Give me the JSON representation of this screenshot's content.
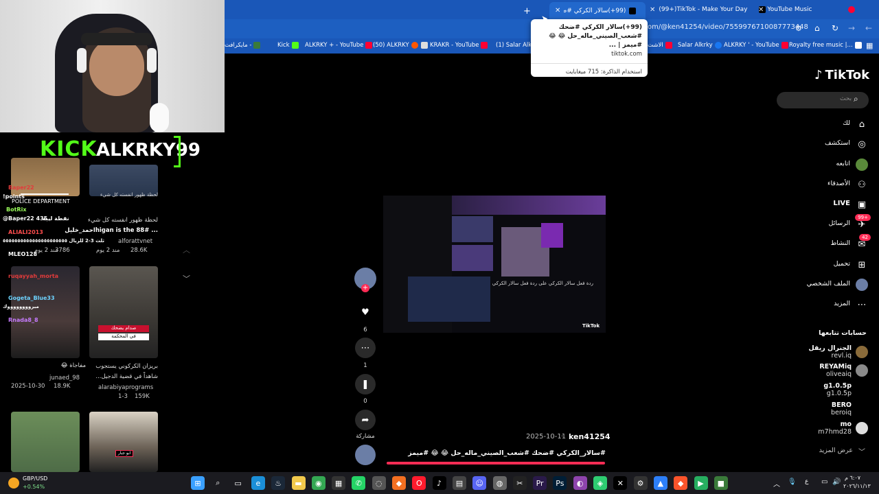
{
  "browser": {
    "tabs": [
      {
        "label": "(99+)سالار الكركي #ضحك #شـ",
        "active": true
      },
      {
        "label": "(99+)TikTok - Make Your Day",
        "active": false
      },
      {
        "label": "YouTube Music",
        "active": false
      }
    ],
    "new_tab_glyph": "+",
    "url": "om/@ken41254/video/7559976710087773448",
    "bookmarks": [
      "مايكرافت -",
      "Kick",
      "ALKRKY + - YouTube",
      "(50) ALKRKY",
      "KRAKR - YouTube",
      "(1) Salar Alkrk",
      "الاشت",
      "Salar Alkrky",
      "ALKRKY ' - YouTube",
      "Royalty free music |..."
    ]
  },
  "tooltip": {
    "line1": "(99+)سالار الكركي #ضحك",
    "line2": "#شعب_الصيني_ماله_حل 😂 😂 #ميمز | ...",
    "site": "tiktok.com",
    "memory": "استخدام الذاكرة: 715 ميغابايت"
  },
  "stream": {
    "platform": "KICK",
    "channel": "ALKRKY99"
  },
  "chat": [
    {
      "user": "Baper22",
      "text": "",
      "color": "#e23b3b"
    },
    {
      "user": "!points",
      "text": "",
      "color": "#ffffff"
    },
    {
      "user": "BotRix",
      "text": "",
      "color": "#9cff5c"
    },
    {
      "user": "@Baper22 435",
      "text": "نقطة ليبه",
      "color": "#ffffff"
    },
    {
      "user": "ALIALI2013",
      "text": "",
      "color": "#ff4d4d"
    },
    {
      "user": "",
      "text": "يرنهوه البارحه برتشوله ثلث 3-2 للريال ٥٥٥٥٥٥٥٥٥٥٥٥٥٥٥٥٥٥٥٥٥٥",
      "color": "#ffffff"
    },
    {
      "user": "MLEO128",
      "text": "",
      "color": "#ffffff"
    },
    {
      "user": "ruqayyah_morta",
      "text": "",
      "color": "#e23b3b"
    },
    {
      "user": "Gogeta_Blue33",
      "text": "",
      "color": "#6dd3ff"
    },
    {
      "user": "",
      "text": "مبرووووووووك",
      "color": "#ffffff"
    },
    {
      "user": "Rnada8_8",
      "text": "",
      "color": "#c67bff"
    }
  ],
  "feed": [
    {
      "title": "لحظة ظهور انفسته كل شيء",
      "title2": "... higan is the 88#احمد_خليل",
      "author": "alforattvnet",
      "meta": "مند 2 يوم",
      "views": "3786",
      "likes": "28.6K"
    },
    {
      "title": "بريزان الكركوني يستجوب",
      "title2": "شاهداً في قضية الدجيل...",
      "author": "alarabiyaprograms",
      "meta": "1-3",
      "views": "159K"
    },
    {
      "title": "مفاجاة 😂",
      "author": "junaed_98",
      "meta": "2025-10-30",
      "views": "18.9K"
    }
  ],
  "thumb_labels": {
    "police": "POLICE DEPARTMENT",
    "saddam": "صدام يضحك",
    "court": "في المحكمة",
    "abujebar": "ابو جبار"
  },
  "video": {
    "author": "ken41254",
    "date": "2025-10-11",
    "caption": "#سالار_الكركي #ضحك #شعب_الصيني_ماله_حل 😂 😂 #ميمز",
    "overlay_text": "ردة فعل سالار الكركي على ردة فعل سالار الكركي على",
    "watermark": "TikTok",
    "likes": "6",
    "comments": "1",
    "saves": "0",
    "share_label": "مشاركة"
  },
  "tiktok": {
    "logo": "TikTok",
    "search_placeholder": "بحث",
    "nav": [
      {
        "label": "لك",
        "icon": "home-icon"
      },
      {
        "label": "استكشف",
        "icon": "compass-icon"
      },
      {
        "label": "اتابعه",
        "icon": "following-icon"
      },
      {
        "label": "الأصدقاء",
        "icon": "friends-icon"
      },
      {
        "label": "LIVE",
        "icon": "live-icon"
      },
      {
        "label": "الرسائل",
        "icon": "messages-icon",
        "badge": "99+"
      },
      {
        "label": "النشاط",
        "icon": "activity-icon",
        "badge": "42"
      },
      {
        "label": "تحميل",
        "icon": "upload-icon"
      },
      {
        "label": "الملف الشخصي",
        "icon": "profile-icon"
      },
      {
        "label": "المزيد",
        "icon": "more-icon"
      }
    ],
    "following_title": "حسابات تتابعها",
    "following": [
      {
        "name": "الجنرال ريقل",
        "handle": "revl.iq"
      },
      {
        "name": "REYAMiq",
        "handle": "oliveaiq"
      },
      {
        "name": "g1.0.5p",
        "handle": "g1.0.5p"
      },
      {
        "name": "BERO",
        "handle": "beroiq"
      },
      {
        "name": "mo",
        "handle": "m7hmd28"
      }
    ],
    "see_more": "عرض المزيد"
  },
  "taskbar": {
    "stock_name": "GBP/USD",
    "stock_change": "+0.54%",
    "time": "٦:٠٧ م",
    "date": "٢٠٢٦/١١/١٣"
  },
  "colors": {
    "accent": "#fe2c55",
    "kick_green": "#53fc18",
    "browser_blue": "#1a57b8"
  }
}
